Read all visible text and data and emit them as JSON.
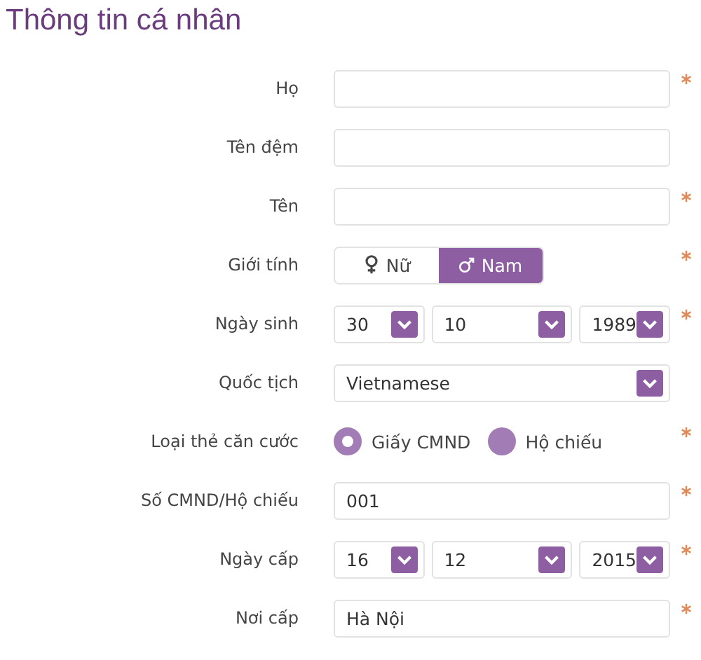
{
  "title": "Thông tin cá nhân",
  "fields": [
    {
      "kind": "text",
      "label": "Họ",
      "required": true
    },
    {
      "kind": "text",
      "label": "Tên đệm",
      "required": false
    },
    {
      "kind": "text",
      "label": "Tên",
      "required": true
    },
    {
      "kind": "gender",
      "label": "Giới tính",
      "required": true,
      "options": [
        {
          "label": "Nữ",
          "kind": "female",
          "selected": false
        },
        {
          "label": "Nam",
          "kind": "male",
          "selected": true
        }
      ]
    },
    {
      "kind": "date",
      "label": "Ngày sinh",
      "required": true,
      "parts": [
        "30",
        "10",
        "1989"
      ]
    },
    {
      "kind": "select",
      "label": "Quốc tịch",
      "required": false,
      "value": "Vietnamese"
    },
    {
      "kind": "radio",
      "label": "Loại thẻ căn cước",
      "required": true,
      "options": [
        {
          "label": "Giấy CMND",
          "selected": true
        },
        {
          "label": "Hộ chiếu",
          "selected": false
        }
      ]
    },
    {
      "kind": "text",
      "label": "Số CMND/Hộ chiếu",
      "required": true,
      "value": "001"
    },
    {
      "kind": "date",
      "label": "Ngày cấp",
      "required": true,
      "parts": [
        "16",
        "12",
        "2015"
      ]
    },
    {
      "kind": "text",
      "label": "Nơi cấp",
      "required": true,
      "value": "Hà Nội"
    }
  ]
}
